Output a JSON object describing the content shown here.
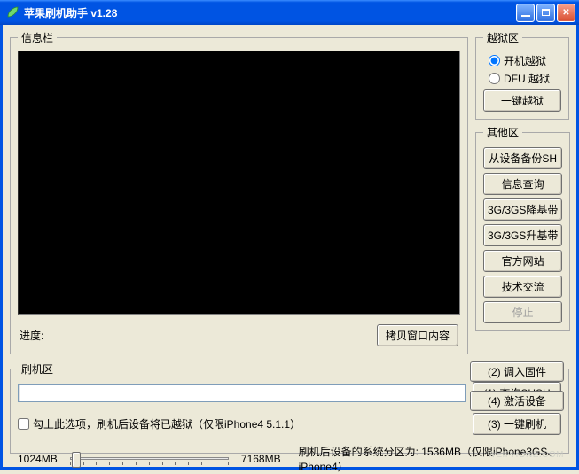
{
  "window": {
    "title": "苹果刷机助手  v1.28"
  },
  "info_panel": {
    "legend": "信息栏",
    "progress_label": "进度:",
    "copy_btn": "拷贝窗口内容"
  },
  "jailbreak": {
    "legend": "越狱区",
    "opt_boot": "开机越狱",
    "opt_dfu": "DFU 越狱",
    "one_key_btn": "一键越狱"
  },
  "other": {
    "legend": "其他区",
    "btn_backup_shsh": "从设备备份SH",
    "btn_info_query": "信息查询",
    "btn_down_baseband": "3G/3GS降基带",
    "btn_up_baseband": "3G/3GS升基带",
    "btn_official_site": "官方网站",
    "btn_tech_exchange": "技术交流",
    "btn_stop": "停止"
  },
  "flash": {
    "legend": "刷机区",
    "btn_query_shsh": "(1) 查询SHSH",
    "btn_load_fw": "(2) 调入固件",
    "chk_label": "勾上此选项，刷机后设备将已越狱（仅限iPhone4 5.1.1）",
    "btn_one_key_flash": "(3) 一键刷机",
    "btn_activate": "(4) 激活设备",
    "size_min": "1024MB",
    "size_max": "7168MB",
    "partition_text": "刷机后设备的系统分区为: 1536MB（仅限iPhone3GS、iPhone4）"
  },
  "watermark": "WEIPHONE.COM"
}
